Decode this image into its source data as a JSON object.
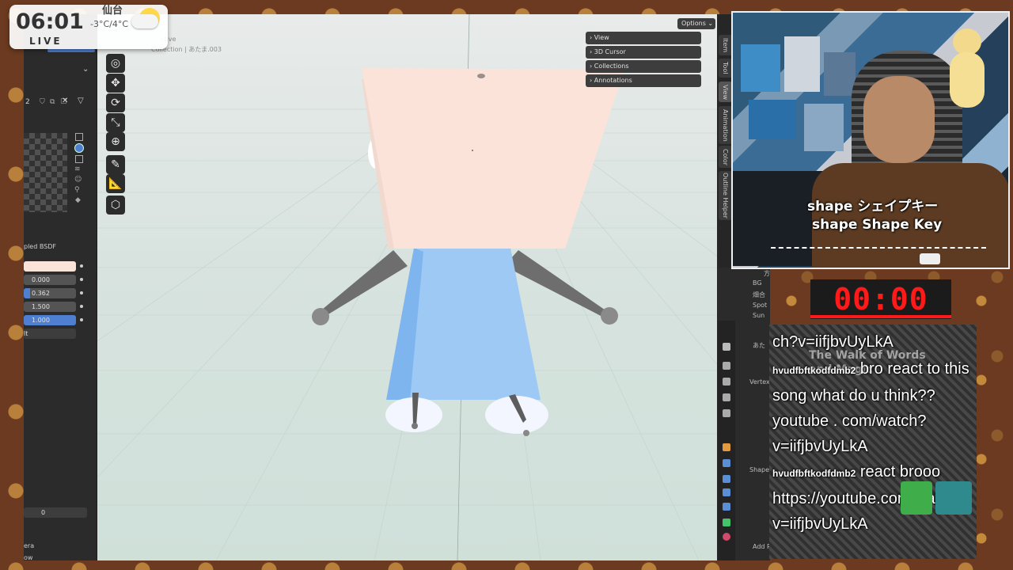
{
  "clock": {
    "time": "06:01",
    "live_label": "LIVE",
    "city": "仙台",
    "temperature": "-3°C/4°C"
  },
  "viewport": {
    "header_partial": "ctive",
    "collection_path": "Collection | あたま.003",
    "options_label": "Options"
  },
  "n_panel": {
    "items": [
      {
        "label": "View"
      },
      {
        "label": "3D Cursor"
      },
      {
        "label": "Collections"
      },
      {
        "label": "Annotations"
      }
    ]
  },
  "side_tabs": [
    "Item",
    "Tool",
    "View",
    "Animation",
    "Color",
    "Outline Helper"
  ],
  "material_panel": {
    "bsdf_label": "pled BSDF",
    "fields": [
      "0.000",
      "0.362",
      "1.500",
      "1.000"
    ],
    "field_partial": "lt",
    "zero_value": "0",
    "bottom_labels": [
      "era",
      "ow"
    ],
    "slot_count": "2"
  },
  "outliner": {
    "items": [
      "方耳.002",
      "BG",
      "畑合",
      "Spot",
      "Sun"
    ],
    "partial_labels": [
      "あた",
      "Vertex",
      "Shape",
      "Add Re",
      "ol",
      "Ic"
    ]
  },
  "camera": {
    "caption_line1": "shape シェイプキー",
    "caption_line2": "shape Shape Key"
  },
  "timer": {
    "display": "00:00"
  },
  "chat": {
    "lines": [
      {
        "user": "",
        "text": "ch?v=iifjbvUyLkA"
      },
      {
        "user": "hvudfbftkodfdmb2",
        "text": "bro react to this song what do u think?? youtube . com/watch? v=iifjbvUyLkA"
      },
      {
        "user": "hvudfbftkodfdmb2",
        "text": "react brooo https://youtube.com/watch?v=iifjbvUyLkA"
      }
    ],
    "background_text": "The Walk of Words and Magic"
  },
  "colors": {
    "timer_red": "#ff1a1a",
    "head": "#fbe3da",
    "body_blue": "#9ec9f5",
    "limb_gray": "#6e6e6e",
    "active_field_blue": "#4f7fd0"
  }
}
